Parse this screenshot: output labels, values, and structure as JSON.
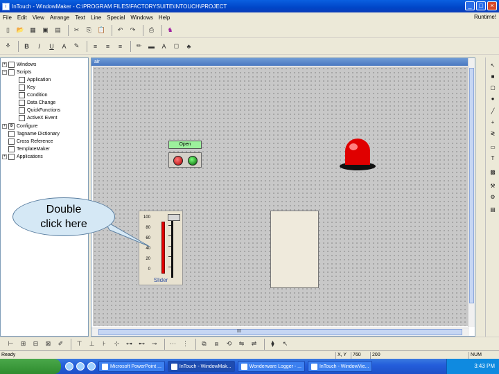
{
  "window": {
    "title": "InTouch - WindowMaker - C:\\PROGRAM FILES\\FACTORYSUITE\\INTOUCH\\PROJECT",
    "runtime_label": "Runtime!"
  },
  "menu": [
    "File",
    "Edit",
    "View",
    "Arrange",
    "Text",
    "Line",
    "Special",
    "Windows",
    "Help"
  ],
  "toolbar1_icons": [
    "new-icon",
    "open-icon",
    "close-icon",
    "save-icon",
    "save-all-icon",
    "cut-icon",
    "copy-icon",
    "paste-icon",
    "undo-icon",
    "redo-icon",
    "print-icon",
    "wizard-icon"
  ],
  "toolbar2": {
    "bold": "B",
    "italic": "I",
    "underline": "U",
    "font_size_icon": "A"
  },
  "tree": {
    "windows": "Windows",
    "scripts": "Scripts",
    "application": "Application",
    "key": "Key",
    "condition": "Condition",
    "data_change": "Data Change",
    "quickfunctions": "QuickFunctions",
    "activex_event": "ActiveX Event",
    "configure": "Configure",
    "tagname_dictionary": "Tagname Dictionary",
    "cross_reference": "Cross Reference",
    "templatemaker": "TemplateMaker",
    "applications": "Applications"
  },
  "callout": {
    "line1": "Double",
    "line2": "click here"
  },
  "canvas": {
    "window_name": "air",
    "open_label": "Open",
    "slider_caption": "Slider",
    "slider_ticks": [
      "100",
      "80",
      "60",
      "40",
      "20",
      "0"
    ],
    "scroll_grip": "III"
  },
  "status": {
    "ready": "Ready",
    "xy_label": "X, Y",
    "x_value": "760",
    "y_value": "200",
    "num": "NUM"
  },
  "taskbar": {
    "tasks": [
      {
        "label": "Microsoft PowerPoint ..."
      },
      {
        "label": "InTouch - WindowMak..."
      },
      {
        "label": "Wonderware Logger - ..."
      },
      {
        "label": "InTouch - WindowVie..."
      }
    ],
    "clock": "3:43 PM"
  }
}
